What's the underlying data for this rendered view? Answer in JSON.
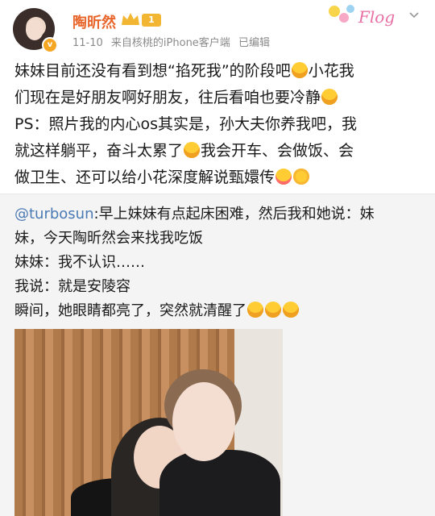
{
  "header": {
    "username": "陶昕然",
    "level": "1",
    "date": "11-10",
    "source": "来自核桃的iPhone客户端",
    "edited": "已编辑",
    "sticker_text": "Flog"
  },
  "post": {
    "line1_a": "妹妹目前还没有看到想“掐死我”的阶段吧",
    "line1_b": "小花我",
    "line2_a": "们现在是好朋友啊好朋友，往后看咱也要冷静",
    "line3": "PS：照片我的内心os其实是，孙大夫你养我吧，我",
    "line4_a": "就这样躺平，奋斗太累了",
    "line4_b": "我会开车、会做饭、会",
    "line5_a": "做卫生、还可以给小花深度解说甄嬛传"
  },
  "repost": {
    "mention": "@turbosun",
    "line1_rest": ":早上妹妹有点起床困难，然后我和她说：妹",
    "line2": "妹，今天陶昕然会来找我吃饭",
    "line3": "妹妹：我不认识……",
    "line4": "我说：就是安陵容",
    "line5": "瞬间，她眼睛都亮了，突然就清醒了"
  },
  "colors": {
    "username": "#e8662b",
    "mention": "#4a7ab5",
    "repost_bg": "#f4f4f4",
    "badge": "#f5a623"
  }
}
